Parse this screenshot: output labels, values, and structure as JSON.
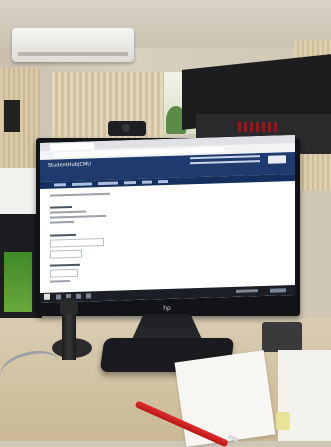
{
  "scene": {
    "colors": {
      "wall": "#d8d0bf",
      "monitor_bezel": "#121316",
      "web_header": "#1f3a6e",
      "web_nav": "#15305f",
      "screen_bg": "#ffffff",
      "pen": "#e22c2c"
    },
    "monitor": {
      "brand_mark": "hp",
      "browser": {
        "header_title": "StudentHub|CMU"
      }
    },
    "icons": [
      "webcam-icon",
      "windows-start-icon",
      "hp-logo-icon"
    ]
  }
}
